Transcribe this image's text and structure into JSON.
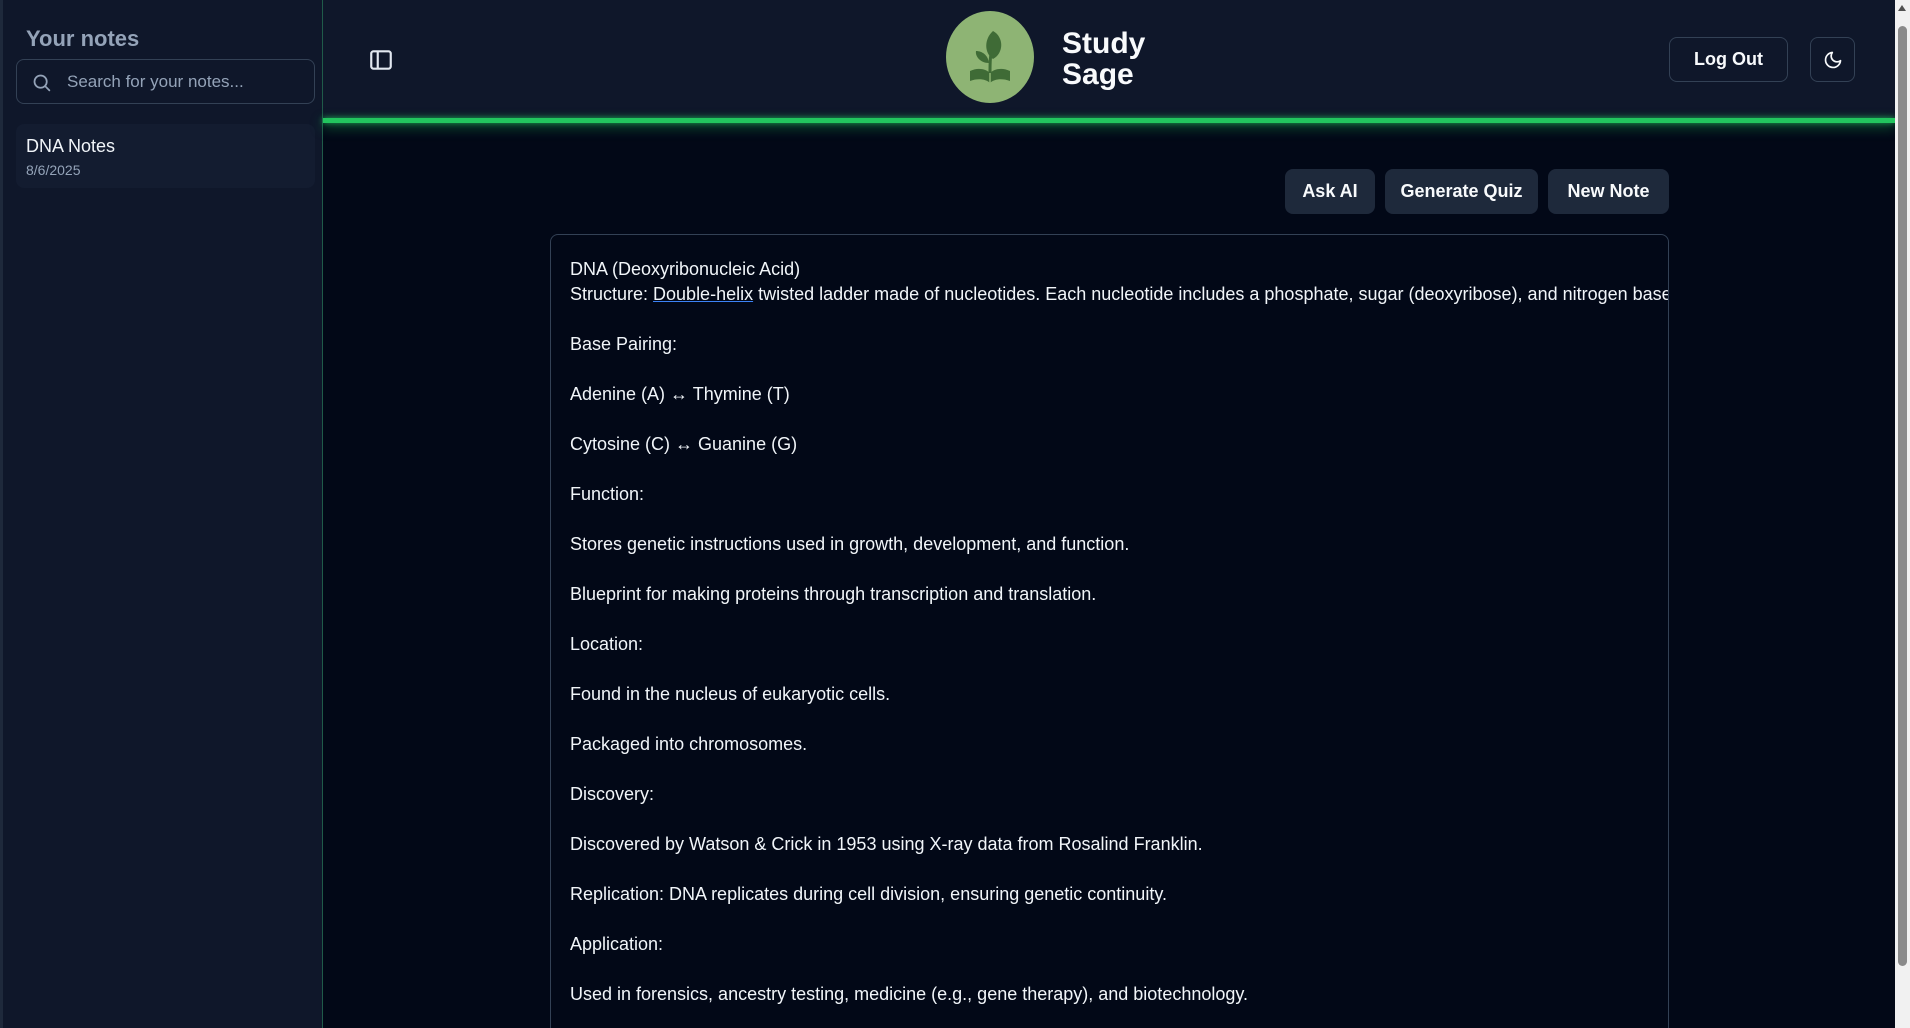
{
  "sidebar": {
    "title": "Your notes",
    "search": {
      "placeholder": "Search for your notes...",
      "value": ""
    },
    "notes": [
      {
        "title": "DNA Notes",
        "date": "8/6/2025"
      }
    ]
  },
  "header": {
    "brand_line1": "Study",
    "brand_line2": "Sage",
    "logout_label": "Log Out",
    "icons": {
      "sidebar_toggle": "panel-left-icon",
      "logo": "leaf-book-logo",
      "theme": "moon-icon",
      "search": "search-icon"
    },
    "accent_color": "#22c55e"
  },
  "actions": {
    "ask_ai": "Ask AI",
    "generate_quiz": "Generate Quiz",
    "new_note": "New Note"
  },
  "editor": {
    "line1": "DNA (Deoxyribonucleic Acid)",
    "line2_prefix": "Structure: ",
    "line2_link": "Double-helix",
    "line2_suffix": " twisted ladder made of nucleotides. Each nucleotide includes a phosphate, sugar (deoxyribose), and nitrogen base.",
    "lines": [
      "Base Pairing:",
      "Adenine (A) ↔ Thymine (T)",
      "Cytosine (C) ↔ Guanine (G)",
      "Function:",
      "Stores genetic instructions used in growth, development, and function.",
      "Blueprint for making proteins through transcription and translation.",
      "Location:",
      "Found in the nucleus of eukaryotic cells.",
      "Packaged into chromosomes.",
      "Discovery:",
      "Discovered by Watson & Crick in 1953 using X-ray data from Rosalind Franklin.",
      "Replication: DNA replicates during cell division, ensuring genetic continuity.",
      "Application:",
      "Used in forensics, ancestry testing, medicine (e.g., gene therapy), and biotechnology."
    ]
  }
}
